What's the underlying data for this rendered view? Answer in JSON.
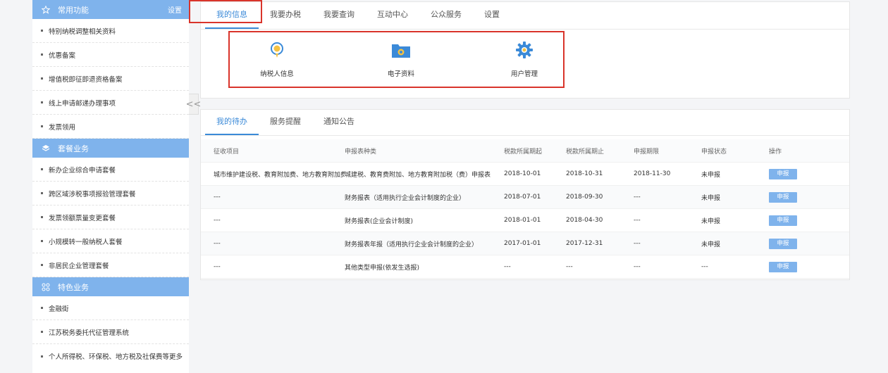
{
  "sidebar": {
    "sections": [
      {
        "title": "常用功能",
        "setting": "设置",
        "items": [
          "特别纳税调整相关资料",
          "优惠备案",
          "增值税即征即退资格备案",
          "线上申请邮递办理事项",
          "发票领用"
        ]
      },
      {
        "title": "套餐业务",
        "items": [
          "新办企业综合申请套餐",
          "跨区域涉税事项报验管理套餐",
          "发票领额票量变更套餐",
          "小规模转一般纳税人套餐",
          "非居民企业管理套餐"
        ]
      },
      {
        "title": "特色业务",
        "items": [
          "金融街",
          "江苏税务委托代征管理系统",
          "个人所得税、环保税、地方税及社保费等更多"
        ]
      }
    ],
    "collapse_glyph": "<<"
  },
  "top_tabs": [
    "我的信息",
    "我要办税",
    "我要查询",
    "互动中心",
    "公众服务",
    "设置"
  ],
  "quick_icons": [
    {
      "label": "纳税人信息",
      "icon": "taxpayer-info-icon"
    },
    {
      "label": "电子资料",
      "icon": "folder-icon"
    },
    {
      "label": "用户管理",
      "icon": "gear-icon"
    }
  ],
  "sub_tabs": [
    "我的待办",
    "服务提醒",
    "通知公告"
  ],
  "table": {
    "headers": [
      "征收项目",
      "申报表种类",
      "税款所属期起",
      "税款所属期止",
      "申报期限",
      "申报状态",
      "操作"
    ],
    "rows": [
      [
        "城市维护建设税、教育附加费、地方教育附加费",
        "城建税、教育费附加、地方教育附加税（费）申报表",
        "2018-10-01",
        "2018-10-31",
        "2018-11-30",
        "未申报",
        "申报"
      ],
      [
        "---",
        "财务报表（适用执行企业会计制度的企业）",
        "2018-07-01",
        "2018-09-30",
        "---",
        "未申报",
        "申报"
      ],
      [
        "---",
        "财务报表(企业会计制度)",
        "2018-01-01",
        "2018-04-30",
        "---",
        "未申报",
        "申报"
      ],
      [
        "---",
        "财务报表年报（适用执行企业会计制度的企业）",
        "2017-01-01",
        "2017-12-31",
        "---",
        "未申报",
        "申报"
      ],
      [
        "---",
        "其他类型申报(依发生选报)",
        "---",
        "---",
        "---",
        "---",
        "申报"
      ]
    ]
  },
  "colors": {
    "accent": "#3b8ad8",
    "section": "#7fb3ec",
    "highlight": "#d9342b"
  }
}
